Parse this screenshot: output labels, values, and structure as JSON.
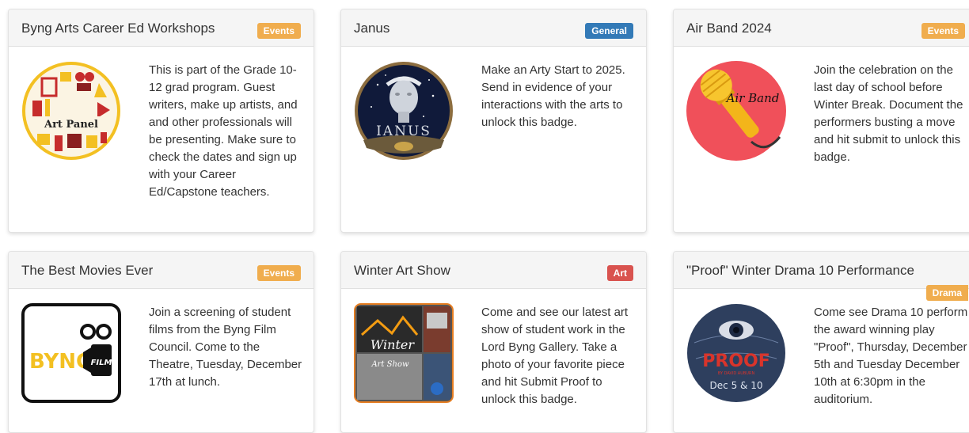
{
  "colors": {
    "events": "#f0ad4e",
    "general": "#337ab7",
    "art": "#d9534f",
    "drama": "#f0ad4e"
  },
  "cards": [
    {
      "title": "Byng Arts Career Ed Workshops",
      "badge": "Events",
      "image_text": "Art Panel",
      "description": "This is part of the Grade 10-12 grad program. Guest writers, make up artists, and and other professionals will be presenting. Make sure to check the dates and sign up with your Career Ed/Capstone teachers."
    },
    {
      "title": "Janus",
      "badge": "General",
      "image_text": "IANUS",
      "description": "Make an Arty Start to 2025. Send in evidence of your interactions with the arts to unlock this badge."
    },
    {
      "title": "Air Band 2024",
      "badge": "Events",
      "image_text": "Air Band",
      "description": "Join the celebration on the last day of school before Winter Break. Document the performers busting a move and hit submit to unlock this badge."
    },
    {
      "title": "The Best Movies Ever",
      "badge": "Events",
      "image_text": "BYNG",
      "image_text_2": "FILM",
      "description": "Join a screening of student films from the Byng Film Council. Come to the Theatre, Tuesday, December 17th at lunch."
    },
    {
      "title": "Winter Art Show",
      "badge": "Art",
      "image_text": "Winter",
      "image_text_2": "Art Show",
      "description": "Come and see our latest art show of student work in the Lord Byng Gallery. Take a photo of your favorite piece and hit Submit Proof to unlock this badge."
    },
    {
      "title": "\"Proof\" Winter Drama 10 Performance",
      "badge": "Drama",
      "image_text": "PROOF",
      "image_text_2": "BY DAVID AUBURN",
      "image_text_3": "Dec 5 & 10",
      "description": "Come see Drama 10 perform the award winning play \"Proof\", Thursday, December 5th and Tuesday December 10th at 6:30pm in the auditorium."
    }
  ]
}
